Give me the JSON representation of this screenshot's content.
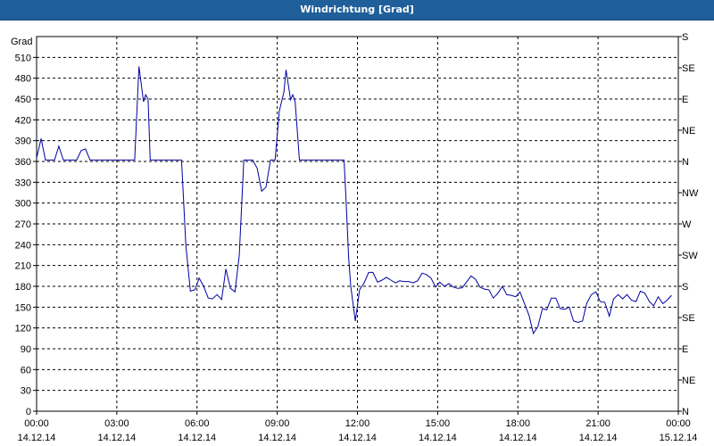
{
  "window": {
    "title": "Windrichtung [Grad]"
  },
  "chart_data": {
    "type": "line",
    "title": "Windrichtung [Grad]",
    "ylabel": "Grad",
    "ylim": [
      0,
      540
    ],
    "yticks": [
      0,
      30,
      60,
      90,
      120,
      150,
      180,
      210,
      240,
      270,
      300,
      330,
      360,
      390,
      420,
      450,
      480,
      510
    ],
    "right_axis_labels": [
      "N",
      "NE",
      "E",
      "SE",
      "S",
      "SW",
      "W",
      "NW",
      "N",
      "NE",
      "E",
      "SE",
      "S"
    ],
    "right_axis_values": [
      0,
      45,
      90,
      135,
      180,
      225,
      270,
      315,
      360,
      405,
      450,
      495,
      540
    ],
    "xlim": [
      0,
      24
    ],
    "xticks": [
      {
        "x": 0,
        "time": "00:00",
        "date": "14.12.14"
      },
      {
        "x": 3,
        "time": "03:00",
        "date": "14.12.14"
      },
      {
        "x": 6,
        "time": "06:00",
        "date": "14.12.14"
      },
      {
        "x": 9,
        "time": "09:00",
        "date": "14.12.14"
      },
      {
        "x": 12,
        "time": "12:00",
        "date": "14.12.14"
      },
      {
        "x": 15,
        "time": "15:00",
        "date": "14.12.14"
      },
      {
        "x": 18,
        "time": "18:00",
        "date": "14.12.14"
      },
      {
        "x": 21,
        "time": "21:00",
        "date": "14.12.14"
      },
      {
        "x": 24,
        "time": "00:00",
        "date": "15.12.14"
      }
    ],
    "grid": true,
    "series": [
      {
        "color": "#0000a0",
        "points": [
          [
            0.0,
            365
          ],
          [
            0.17,
            393
          ],
          [
            0.33,
            362
          ],
          [
            0.67,
            362
          ],
          [
            0.83,
            382
          ],
          [
            1.0,
            362
          ],
          [
            1.5,
            362
          ],
          [
            1.67,
            376
          ],
          [
            1.83,
            378
          ],
          [
            2.0,
            362
          ],
          [
            3.67,
            362
          ],
          [
            3.83,
            497
          ],
          [
            4.0,
            446
          ],
          [
            4.08,
            456
          ],
          [
            4.17,
            450
          ],
          [
            4.25,
            362
          ],
          [
            5.42,
            362
          ],
          [
            5.58,
            240
          ],
          [
            5.75,
            173
          ],
          [
            5.92,
            175
          ],
          [
            6.08,
            192
          ],
          [
            6.25,
            180
          ],
          [
            6.42,
            163
          ],
          [
            6.58,
            162
          ],
          [
            6.75,
            168
          ],
          [
            6.92,
            161
          ],
          [
            7.08,
            205
          ],
          [
            7.25,
            177
          ],
          [
            7.42,
            172
          ],
          [
            7.58,
            225
          ],
          [
            7.75,
            362
          ],
          [
            8.08,
            362
          ],
          [
            8.25,
            350
          ],
          [
            8.42,
            317
          ],
          [
            8.58,
            323
          ],
          [
            8.75,
            362
          ],
          [
            8.92,
            362
          ],
          [
            9.08,
            433
          ],
          [
            9.25,
            460
          ],
          [
            9.33,
            492
          ],
          [
            9.5,
            449
          ],
          [
            9.58,
            456
          ],
          [
            9.67,
            446
          ],
          [
            9.83,
            362
          ],
          [
            11.5,
            362
          ],
          [
            11.58,
            300
          ],
          [
            11.67,
            222
          ],
          [
            11.75,
            180
          ],
          [
            11.92,
            130
          ],
          [
            12.08,
            175
          ],
          [
            12.25,
            185
          ],
          [
            12.42,
            200
          ],
          [
            12.58,
            200
          ],
          [
            12.75,
            186
          ],
          [
            12.92,
            189
          ],
          [
            13.08,
            193
          ],
          [
            13.25,
            189
          ],
          [
            13.42,
            185
          ],
          [
            13.58,
            188
          ],
          [
            13.75,
            187
          ],
          [
            13.92,
            187
          ],
          [
            14.08,
            185
          ],
          [
            14.25,
            188
          ],
          [
            14.42,
            199
          ],
          [
            14.58,
            197
          ],
          [
            14.75,
            192
          ],
          [
            14.92,
            179
          ],
          [
            15.08,
            186
          ],
          [
            15.25,
            180
          ],
          [
            15.42,
            184
          ],
          [
            15.58,
            179
          ],
          [
            15.75,
            177
          ],
          [
            15.92,
            178
          ],
          [
            16.08,
            186
          ],
          [
            16.25,
            195
          ],
          [
            16.42,
            190
          ],
          [
            16.58,
            179
          ],
          [
            16.75,
            176
          ],
          [
            16.92,
            175
          ],
          [
            17.08,
            163
          ],
          [
            17.25,
            170
          ],
          [
            17.42,
            180
          ],
          [
            17.58,
            168
          ],
          [
            17.75,
            167
          ],
          [
            17.92,
            165
          ],
          [
            18.08,
            172
          ],
          [
            18.25,
            155
          ],
          [
            18.42,
            138
          ],
          [
            18.58,
            112
          ],
          [
            18.75,
            122
          ],
          [
            18.92,
            148
          ],
          [
            19.08,
            146
          ],
          [
            19.25,
            163
          ],
          [
            19.42,
            163
          ],
          [
            19.58,
            148
          ],
          [
            19.75,
            147
          ],
          [
            19.92,
            150
          ],
          [
            20.08,
            130
          ],
          [
            20.25,
            128
          ],
          [
            20.42,
            130
          ],
          [
            20.58,
            156
          ],
          [
            20.75,
            168
          ],
          [
            20.92,
            172
          ],
          [
            21.08,
            158
          ],
          [
            21.25,
            157
          ],
          [
            21.42,
            137
          ],
          [
            21.58,
            162
          ],
          [
            21.75,
            168
          ],
          [
            21.92,
            162
          ],
          [
            22.08,
            168
          ],
          [
            22.25,
            160
          ],
          [
            22.42,
            158
          ],
          [
            22.58,
            173
          ],
          [
            22.75,
            170
          ],
          [
            22.92,
            158
          ],
          [
            23.08,
            152
          ],
          [
            23.25,
            165
          ],
          [
            23.42,
            155
          ],
          [
            23.58,
            160
          ],
          [
            23.75,
            167
          ]
        ]
      }
    ]
  }
}
